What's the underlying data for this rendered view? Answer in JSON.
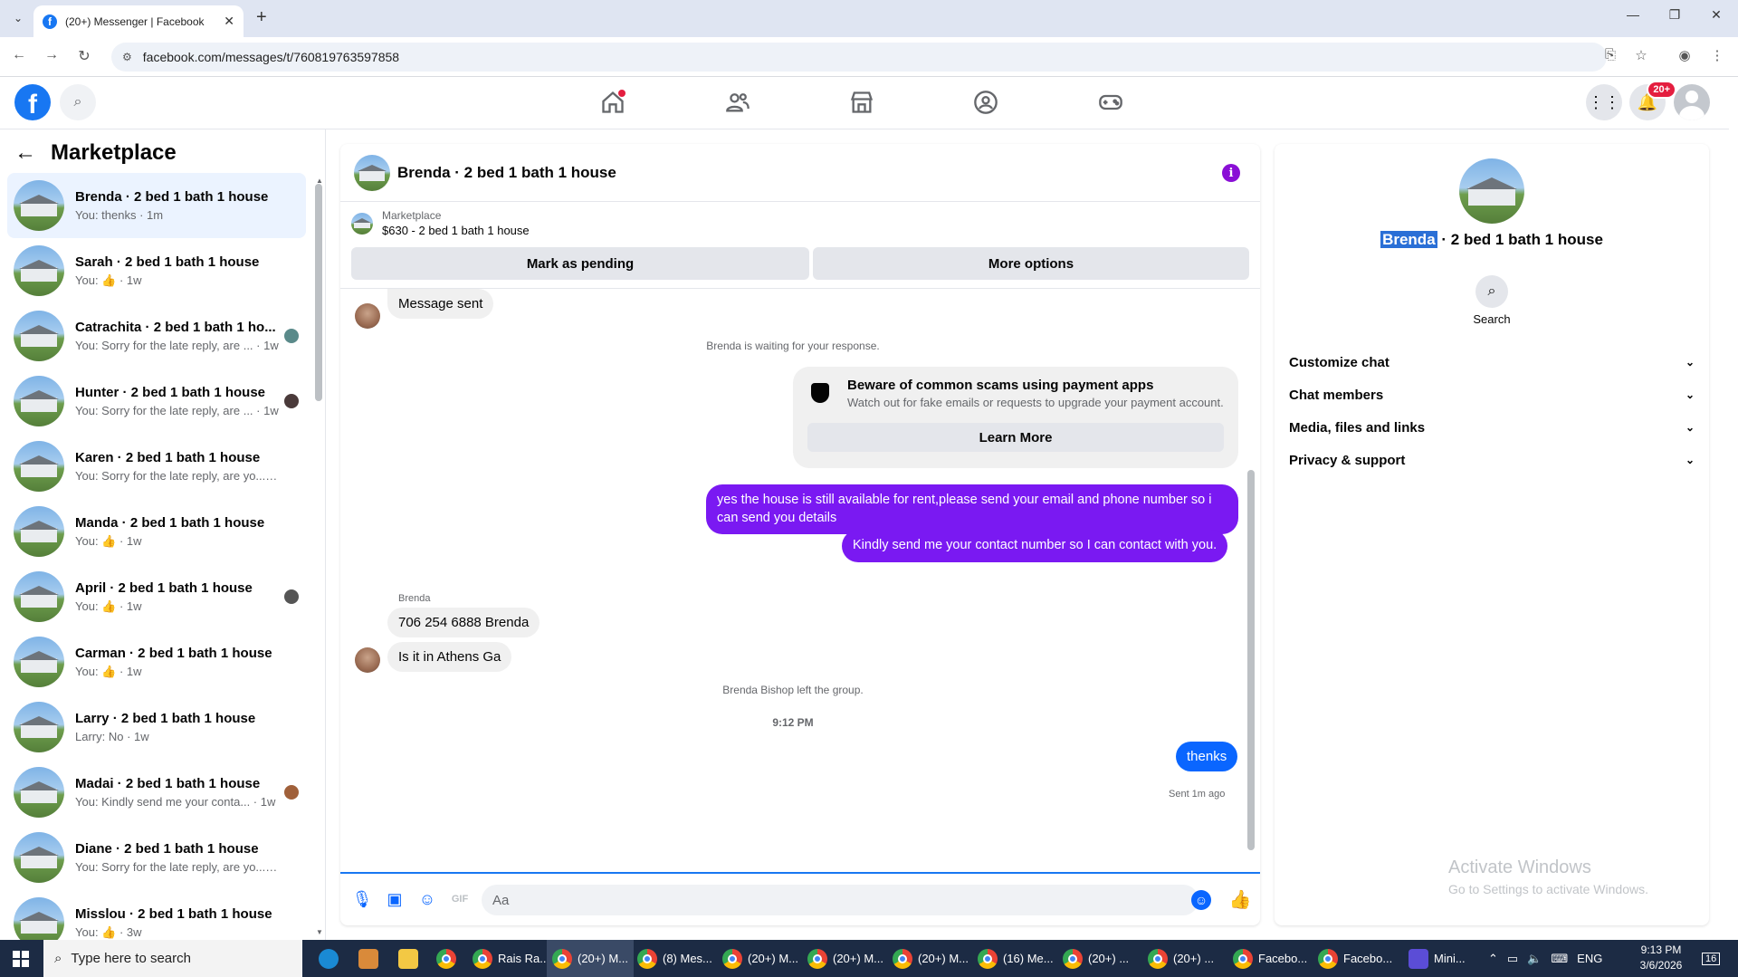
{
  "browser": {
    "tab_title": "(20+) Messenger | Facebook",
    "url": "facebook.com/messages/t/760819763597858"
  },
  "header": {
    "notification_badge": "20+"
  },
  "sidebar": {
    "title": "Marketplace",
    "conversations": [
      {
        "name": "Brenda · 2 bed 1 bath 1 house",
        "preview": "You: thenks · 1m",
        "active": true
      },
      {
        "name": "Sarah · 2 bed 1 bath 1 house",
        "preview": "You: 👍 · 1w"
      },
      {
        "name": "Catrachita · 2 bed 1 bath 1 ho...",
        "preview": "You: Sorry for the late reply, are ... · 1w"
      },
      {
        "name": "Hunter · 2 bed 1 bath 1 house",
        "preview": "You: Sorry for the late reply, are ... · 1w"
      },
      {
        "name": "Karen · 2 bed 1 bath 1 house",
        "preview": "You: Sorry for the late reply, are yo... · 1w"
      },
      {
        "name": "Manda · 2 bed 1 bath 1 house",
        "preview": "You: 👍 · 1w"
      },
      {
        "name": "April · 2 bed 1 bath 1 house",
        "preview": "You: 👍 · 1w"
      },
      {
        "name": "Carman · 2 bed 1 bath 1 house",
        "preview": "You: 👍 · 1w"
      },
      {
        "name": "Larry · 2 bed 1 bath 1 house",
        "preview": "Larry: No · 1w"
      },
      {
        "name": "Madai · 2 bed 1 bath 1 house",
        "preview": "You: Kindly send me your conta... · 1w"
      },
      {
        "name": "Diane · 2 bed 1 bath 1 house",
        "preview": "You: Sorry for the late reply, are yo... · 1w"
      },
      {
        "name": "Misslou · 2 bed 1 bath 1 house",
        "preview": "You: 👍 · 3w"
      }
    ]
  },
  "chat": {
    "title": "Brenda · 2 bed 1 bath 1 house",
    "marketplace_label": "Marketplace",
    "listing": "$630 - 2 bed 1 bath 1 house",
    "mark_pending": "Mark as pending",
    "more_options": "More options",
    "message_sent": "Message sent",
    "waiting": "Brenda is waiting for your response.",
    "scam_title": "Beware of common scams using payment apps",
    "scam_sub": "Watch out for fake emails or requests to upgrade your payment account.",
    "learn_more": "Learn More",
    "out_msg_1": "yes the house is still available for rent,please send your email and phone number so i can send you details",
    "out_msg_2": "Kindly send me your contact number so I can contact with you.",
    "sender": "Brenda",
    "in_msg_1": "706 254 6888 Brenda",
    "in_msg_2": "Is it in Athens Ga",
    "left_group": "Brenda Bishop left the group.",
    "time": "9:12 PM",
    "out_msg_3": "thenks",
    "sent_status": "Sent 1m ago",
    "composer_placeholder": "Aa"
  },
  "details": {
    "name_highlight": "Brenda",
    "name_rest": " · 2 bed 1 bath 1 house",
    "search_label": "Search",
    "sections": [
      "Customize chat",
      "Chat members",
      "Media, files and links",
      "Privacy & support"
    ]
  },
  "watermark": {
    "line1": "Activate Windows",
    "line2": "Go to Settings to activate Windows."
  },
  "taskbar": {
    "search_placeholder": "Type here to search",
    "apps": [
      "Rais Ra...",
      "(20+) M...",
      "(8) Mes...",
      "(20+) M...",
      "(20+) M...",
      "(20+) M...",
      "(16) Me...",
      "(20+) ...",
      "(20+) ...",
      "Facebo...",
      "Facebo...",
      "Mini..."
    ],
    "lang": "ENG",
    "time": "9:13 PM",
    "date": "3/6/2026",
    "notif_count": "16"
  },
  "colors": {
    "fb_blue": "#1877f2",
    "outgoing_bubble": "#7a19f2",
    "incoming_bubble": "#f0f0f0",
    "active_conversation": "#ebf3ff"
  }
}
